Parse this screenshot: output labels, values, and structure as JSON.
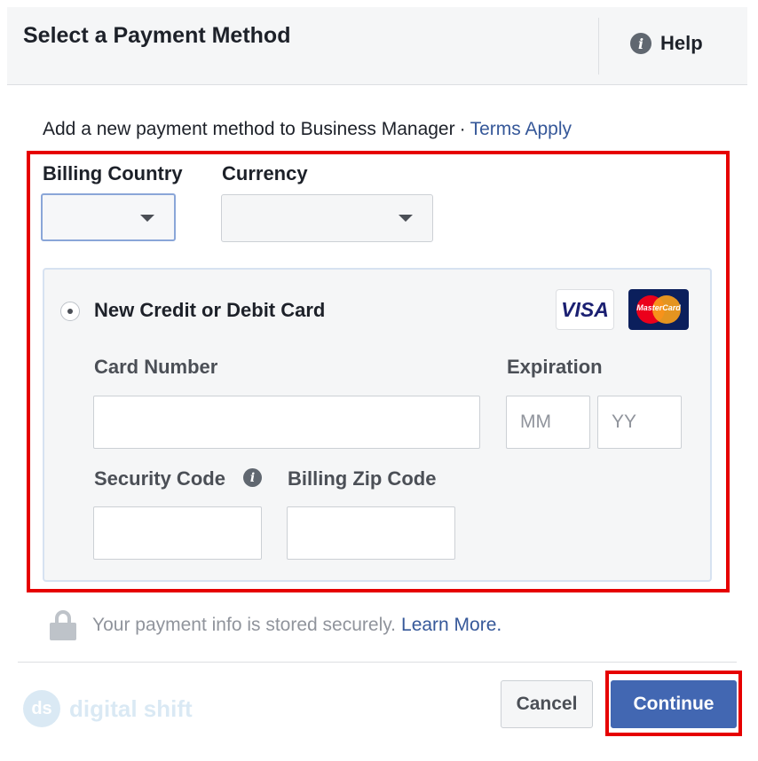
{
  "header": {
    "title": "Select a Payment Method",
    "help_label": "Help",
    "help_icon": "info-icon"
  },
  "intro": {
    "text": "Add a new payment method to Business Manager",
    "separator": "·",
    "terms_link": "Terms Apply"
  },
  "billing_country": {
    "label": "Billing Country",
    "selected": ""
  },
  "currency": {
    "label": "Currency",
    "selected": ""
  },
  "card": {
    "option_label": "New Credit or Debit Card",
    "selected": true,
    "visa_label": "VISA",
    "mastercard_label": "MasterCard",
    "card_number_label": "Card Number",
    "card_number_value": "",
    "expiration_label": "Expiration",
    "mm_placeholder": "MM",
    "yy_placeholder": "YY",
    "security_code_label": "Security Code",
    "security_code_value": "",
    "zip_label": "Billing Zip Code",
    "zip_value": ""
  },
  "secure": {
    "text": "Your payment info is stored securely.",
    "learn_more": "Learn More."
  },
  "footer": {
    "brand_logo": "ds",
    "brand_text": "digital shift",
    "cancel_label": "Cancel",
    "continue_label": "Continue"
  },
  "colors": {
    "highlight": "#e60000",
    "primary_button": "#4267b2",
    "link": "#365899"
  }
}
